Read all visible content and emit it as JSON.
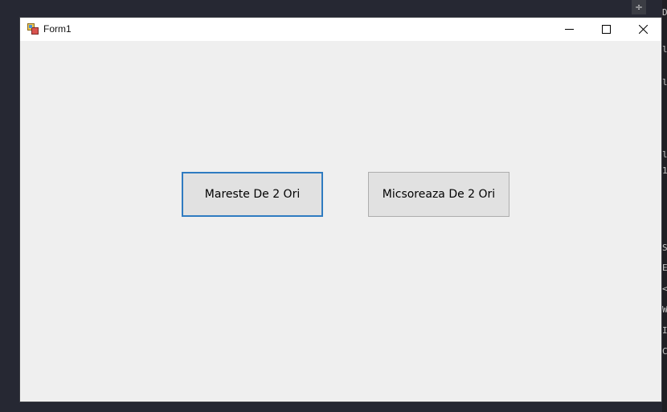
{
  "window": {
    "title": "Form1",
    "controls": {
      "minimize_icon": "minimize-icon",
      "maximize_icon": "maximize-icon",
      "close_icon": "close-icon"
    }
  },
  "form": {
    "buttons": [
      {
        "label": "Mareste De 2 Ori",
        "focused": true
      },
      {
        "label": "Micsoreaza De 2 Ori",
        "focused": false
      }
    ]
  },
  "background_ide": {
    "top_icon": "split-icon",
    "edge_chars": [
      "D",
      "l",
      "l",
      "l",
      "1",
      "S",
      "E",
      "<",
      "W",
      "I",
      "C"
    ]
  },
  "colors": {
    "focus_border": "#2f7bc1",
    "button_bg": "#e1e1e1",
    "client_bg": "#efefef",
    "titlebar_bg": "#ffffff",
    "desktop_bg": "#262833"
  }
}
